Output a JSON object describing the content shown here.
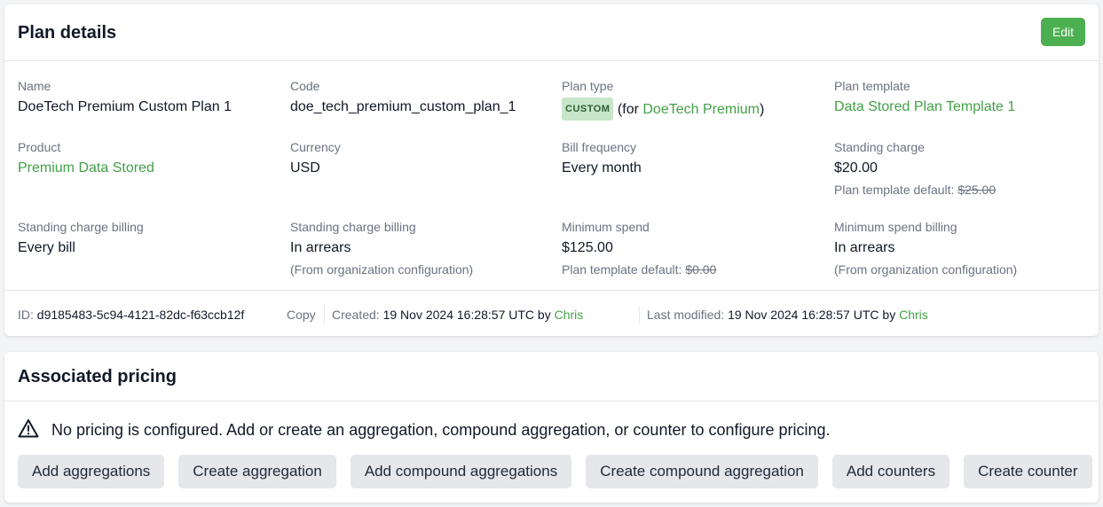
{
  "plan": {
    "title": "Plan details",
    "edit_label": "Edit",
    "fields": {
      "name": {
        "label": "Name",
        "value": "DoeTech Premium Custom Plan 1"
      },
      "code": {
        "label": "Code",
        "value": "doe_tech_premium_custom_plan_1"
      },
      "plan_type": {
        "label": "Plan type",
        "badge": "CUSTOM",
        "prefix": "(for ",
        "link": "DoeTech Premium",
        "suffix": ")"
      },
      "plan_template": {
        "label": "Plan template",
        "value": "Data Stored Plan Template 1"
      },
      "product": {
        "label": "Product",
        "value": "Premium Data Stored"
      },
      "currency": {
        "label": "Currency",
        "value": "USD"
      },
      "bill_frequency": {
        "label": "Bill frequency",
        "value": "Every month"
      },
      "standing_charge": {
        "label": "Standing charge",
        "value": "$20.00",
        "sub_label": "Plan template default: ",
        "sub_value": "$25.00"
      },
      "standing_charge_billing_1": {
        "label": "Standing charge billing",
        "value": "Every bill"
      },
      "standing_charge_billing_2": {
        "label": "Standing charge billing",
        "value": "In arrears",
        "sub": "(From organization configuration)"
      },
      "minimum_spend": {
        "label": "Minimum spend",
        "value": "$125.00",
        "sub_label": "Plan template default: ",
        "sub_value": "$0.00"
      },
      "minimum_spend_billing": {
        "label": "Minimum spend billing",
        "value": "In arrears",
        "sub": "(From organization configuration)"
      }
    },
    "meta": {
      "id_label": "ID: ",
      "id_value": "d9185483-5c94-4121-82dc-f63ccb12f",
      "copy_label": "Copy",
      "created_label": "Created: ",
      "created_value": "19 Nov 2024 16:28:57 UTC",
      "created_by_label": " by ",
      "created_by": "Chris",
      "modified_label": "Last modified: ",
      "modified_value": "19 Nov 2024 16:28:57 UTC",
      "modified_by_label": " by ",
      "modified_by": "Chris"
    }
  },
  "pricing": {
    "title": "Associated pricing",
    "warning_icon": "warning-triangle-icon",
    "warning": "No pricing is configured. Add or create an aggregation, compound aggregation, or counter to configure pricing.",
    "buttons": {
      "add_aggregations": "Add aggregations",
      "create_aggregation": "Create aggregation",
      "add_compound_aggregations": "Add compound aggregations",
      "create_compound_aggregation": "Create compound aggregation",
      "add_counters": "Add counters",
      "create_counter": "Create counter"
    }
  },
  "colors": {
    "accent_green": "#4caf50",
    "link_green": "#43a047",
    "badge_bg": "#c8e6c9"
  }
}
